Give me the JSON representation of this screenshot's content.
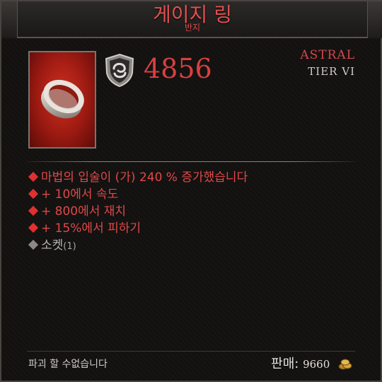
{
  "item": {
    "name": "게이지 링",
    "type": "반지",
    "quality": "ASTRAL",
    "tier": "TIER VI",
    "power": "4856",
    "power_icon": "shield-swirl-icon",
    "image_icon": "ring-icon"
  },
  "affixes": [
    {
      "text": "마법의 입술이 (가) 240 % 증가했습니다",
      "kind": "magic"
    },
    {
      "text": "+ 10에서 속도",
      "kind": "magic"
    },
    {
      "text": "+ 800에서 재치",
      "kind": "magic"
    },
    {
      "text": "+ 15%에서 피하기",
      "kind": "magic"
    },
    {
      "text": "소켓",
      "count": "(1)",
      "kind": "socket"
    }
  ],
  "footer": {
    "note": "파괴 할 수없습니다",
    "sell_label": "판매:",
    "sell_value": "9660",
    "currency_icon": "gold-coins-icon"
  },
  "colors": {
    "magic": "#e04848",
    "socket": "#b8b4b0",
    "portrait_bg": "#b22418"
  }
}
